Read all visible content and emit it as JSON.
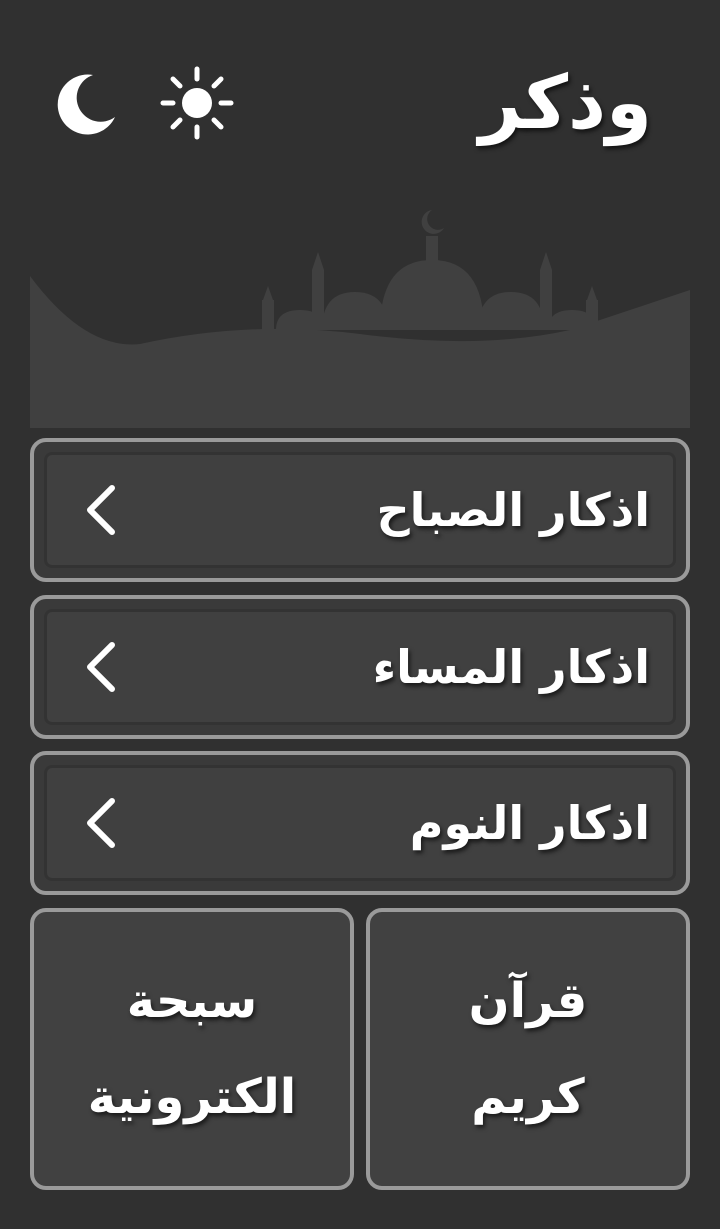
{
  "header": {
    "title": "وذكر",
    "moon_icon": "moon-icon",
    "sun_icon": "sun-icon"
  },
  "banner": {
    "icon": "mosque-silhouette-icon",
    "color": "#404040"
  },
  "menu": {
    "items": [
      {
        "label": "اذكار الصباح",
        "icon": "chevron-left-icon"
      },
      {
        "label": "اذكار المساء",
        "icon": "chevron-left-icon"
      },
      {
        "label": "اذكار النوم",
        "icon": "chevron-left-icon"
      }
    ]
  },
  "tiles": {
    "quran": {
      "line1": "قرآن",
      "line2": "كريم"
    },
    "tasbih": {
      "line1": "سبحة",
      "line2": "الكترونية"
    }
  },
  "colors": {
    "background": "#303030",
    "border": "#9a9a9a",
    "surface": "#404040",
    "text": "#ffffff"
  }
}
